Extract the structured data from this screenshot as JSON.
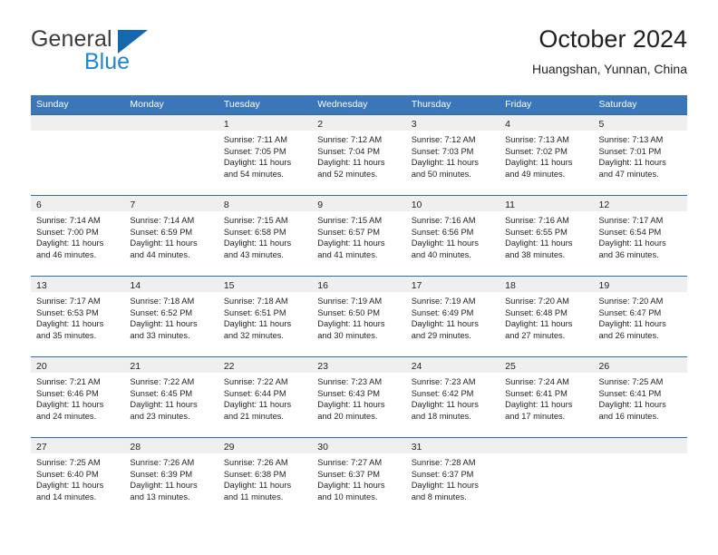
{
  "brand": {
    "name_top": "General",
    "name_bottom": "Blue",
    "triangle_color": "#1369b0",
    "text_color_top": "#3c3c3b",
    "text_color_bottom": "#1f86d0"
  },
  "header": {
    "title": "October 2024",
    "subtitle": "Huangshan, Yunnan, China"
  },
  "theme": {
    "header_row_bg": "#3a76b8",
    "row_divider": "#2f6cad",
    "day_strip_bg": "#efefef",
    "text": "#231f20"
  },
  "weekdays": [
    "Sunday",
    "Monday",
    "Tuesday",
    "Wednesday",
    "Thursday",
    "Friday",
    "Saturday"
  ],
  "labels": {
    "sunrise_prefix": "Sunrise:",
    "sunset_prefix": "Sunset:",
    "daylight_prefix": "Daylight:"
  },
  "weeks": [
    [
      {
        "day": "",
        "sunrise": "",
        "sunset": "",
        "daylight_line1": "",
        "daylight_line2": ""
      },
      {
        "day": "",
        "sunrise": "",
        "sunset": "",
        "daylight_line1": "",
        "daylight_line2": ""
      },
      {
        "day": "1",
        "sunrise": "Sunrise: 7:11 AM",
        "sunset": "Sunset: 7:05 PM",
        "daylight_line1": "Daylight: 11 hours",
        "daylight_line2": "and 54 minutes."
      },
      {
        "day": "2",
        "sunrise": "Sunrise: 7:12 AM",
        "sunset": "Sunset: 7:04 PM",
        "daylight_line1": "Daylight: 11 hours",
        "daylight_line2": "and 52 minutes."
      },
      {
        "day": "3",
        "sunrise": "Sunrise: 7:12 AM",
        "sunset": "Sunset: 7:03 PM",
        "daylight_line1": "Daylight: 11 hours",
        "daylight_line2": "and 50 minutes."
      },
      {
        "day": "4",
        "sunrise": "Sunrise: 7:13 AM",
        "sunset": "Sunset: 7:02 PM",
        "daylight_line1": "Daylight: 11 hours",
        "daylight_line2": "and 49 minutes."
      },
      {
        "day": "5",
        "sunrise": "Sunrise: 7:13 AM",
        "sunset": "Sunset: 7:01 PM",
        "daylight_line1": "Daylight: 11 hours",
        "daylight_line2": "and 47 minutes."
      }
    ],
    [
      {
        "day": "6",
        "sunrise": "Sunrise: 7:14 AM",
        "sunset": "Sunset: 7:00 PM",
        "daylight_line1": "Daylight: 11 hours",
        "daylight_line2": "and 46 minutes."
      },
      {
        "day": "7",
        "sunrise": "Sunrise: 7:14 AM",
        "sunset": "Sunset: 6:59 PM",
        "daylight_line1": "Daylight: 11 hours",
        "daylight_line2": "and 44 minutes."
      },
      {
        "day": "8",
        "sunrise": "Sunrise: 7:15 AM",
        "sunset": "Sunset: 6:58 PM",
        "daylight_line1": "Daylight: 11 hours",
        "daylight_line2": "and 43 minutes."
      },
      {
        "day": "9",
        "sunrise": "Sunrise: 7:15 AM",
        "sunset": "Sunset: 6:57 PM",
        "daylight_line1": "Daylight: 11 hours",
        "daylight_line2": "and 41 minutes."
      },
      {
        "day": "10",
        "sunrise": "Sunrise: 7:16 AM",
        "sunset": "Sunset: 6:56 PM",
        "daylight_line1": "Daylight: 11 hours",
        "daylight_line2": "and 40 minutes."
      },
      {
        "day": "11",
        "sunrise": "Sunrise: 7:16 AM",
        "sunset": "Sunset: 6:55 PM",
        "daylight_line1": "Daylight: 11 hours",
        "daylight_line2": "and 38 minutes."
      },
      {
        "day": "12",
        "sunrise": "Sunrise: 7:17 AM",
        "sunset": "Sunset: 6:54 PM",
        "daylight_line1": "Daylight: 11 hours",
        "daylight_line2": "and 36 minutes."
      }
    ],
    [
      {
        "day": "13",
        "sunrise": "Sunrise: 7:17 AM",
        "sunset": "Sunset: 6:53 PM",
        "daylight_line1": "Daylight: 11 hours",
        "daylight_line2": "and 35 minutes."
      },
      {
        "day": "14",
        "sunrise": "Sunrise: 7:18 AM",
        "sunset": "Sunset: 6:52 PM",
        "daylight_line1": "Daylight: 11 hours",
        "daylight_line2": "and 33 minutes."
      },
      {
        "day": "15",
        "sunrise": "Sunrise: 7:18 AM",
        "sunset": "Sunset: 6:51 PM",
        "daylight_line1": "Daylight: 11 hours",
        "daylight_line2": "and 32 minutes."
      },
      {
        "day": "16",
        "sunrise": "Sunrise: 7:19 AM",
        "sunset": "Sunset: 6:50 PM",
        "daylight_line1": "Daylight: 11 hours",
        "daylight_line2": "and 30 minutes."
      },
      {
        "day": "17",
        "sunrise": "Sunrise: 7:19 AM",
        "sunset": "Sunset: 6:49 PM",
        "daylight_line1": "Daylight: 11 hours",
        "daylight_line2": "and 29 minutes."
      },
      {
        "day": "18",
        "sunrise": "Sunrise: 7:20 AM",
        "sunset": "Sunset: 6:48 PM",
        "daylight_line1": "Daylight: 11 hours",
        "daylight_line2": "and 27 minutes."
      },
      {
        "day": "19",
        "sunrise": "Sunrise: 7:20 AM",
        "sunset": "Sunset: 6:47 PM",
        "daylight_line1": "Daylight: 11 hours",
        "daylight_line2": "and 26 minutes."
      }
    ],
    [
      {
        "day": "20",
        "sunrise": "Sunrise: 7:21 AM",
        "sunset": "Sunset: 6:46 PM",
        "daylight_line1": "Daylight: 11 hours",
        "daylight_line2": "and 24 minutes."
      },
      {
        "day": "21",
        "sunrise": "Sunrise: 7:22 AM",
        "sunset": "Sunset: 6:45 PM",
        "daylight_line1": "Daylight: 11 hours",
        "daylight_line2": "and 23 minutes."
      },
      {
        "day": "22",
        "sunrise": "Sunrise: 7:22 AM",
        "sunset": "Sunset: 6:44 PM",
        "daylight_line1": "Daylight: 11 hours",
        "daylight_line2": "and 21 minutes."
      },
      {
        "day": "23",
        "sunrise": "Sunrise: 7:23 AM",
        "sunset": "Sunset: 6:43 PM",
        "daylight_line1": "Daylight: 11 hours",
        "daylight_line2": "and 20 minutes."
      },
      {
        "day": "24",
        "sunrise": "Sunrise: 7:23 AM",
        "sunset": "Sunset: 6:42 PM",
        "daylight_line1": "Daylight: 11 hours",
        "daylight_line2": "and 18 minutes."
      },
      {
        "day": "25",
        "sunrise": "Sunrise: 7:24 AM",
        "sunset": "Sunset: 6:41 PM",
        "daylight_line1": "Daylight: 11 hours",
        "daylight_line2": "and 17 minutes."
      },
      {
        "day": "26",
        "sunrise": "Sunrise: 7:25 AM",
        "sunset": "Sunset: 6:41 PM",
        "daylight_line1": "Daylight: 11 hours",
        "daylight_line2": "and 16 minutes."
      }
    ],
    [
      {
        "day": "27",
        "sunrise": "Sunrise: 7:25 AM",
        "sunset": "Sunset: 6:40 PM",
        "daylight_line1": "Daylight: 11 hours",
        "daylight_line2": "and 14 minutes."
      },
      {
        "day": "28",
        "sunrise": "Sunrise: 7:26 AM",
        "sunset": "Sunset: 6:39 PM",
        "daylight_line1": "Daylight: 11 hours",
        "daylight_line2": "and 13 minutes."
      },
      {
        "day": "29",
        "sunrise": "Sunrise: 7:26 AM",
        "sunset": "Sunset: 6:38 PM",
        "daylight_line1": "Daylight: 11 hours",
        "daylight_line2": "and 11 minutes."
      },
      {
        "day": "30",
        "sunrise": "Sunrise: 7:27 AM",
        "sunset": "Sunset: 6:37 PM",
        "daylight_line1": "Daylight: 11 hours",
        "daylight_line2": "and 10 minutes."
      },
      {
        "day": "31",
        "sunrise": "Sunrise: 7:28 AM",
        "sunset": "Sunset: 6:37 PM",
        "daylight_line1": "Daylight: 11 hours",
        "daylight_line2": "and 8 minutes."
      },
      {
        "day": "",
        "sunrise": "",
        "sunset": "",
        "daylight_line1": "",
        "daylight_line2": ""
      },
      {
        "day": "",
        "sunrise": "",
        "sunset": "",
        "daylight_line1": "",
        "daylight_line2": ""
      }
    ]
  ]
}
